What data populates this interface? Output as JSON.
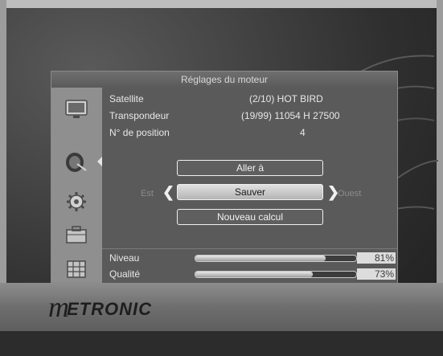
{
  "window": {
    "title": "Réglages du moteur"
  },
  "info": {
    "satellite_label": "Satellite",
    "satellite_value": "(2/10) HOT BIRD",
    "transponder_label": "Transpondeur",
    "transponder_value": "(19/99) 11054 H 27500",
    "position_label": "N° de position",
    "position_value": "4"
  },
  "actions": {
    "goto_label": "Aller à",
    "save_label": "Sauver",
    "recalc_label": "Nouveau calcul"
  },
  "direction": {
    "east": "Est",
    "west": "Ouest",
    "left_arrow": "❮",
    "right_arrow": "❯"
  },
  "signal": {
    "level_label": "Niveau",
    "level_value": "81%",
    "level_fraction": 0.81,
    "quality_label": "Qualité",
    "quality_value": "73%",
    "quality_fraction": 0.73
  },
  "sidebar": {
    "items": [
      "tv-icon",
      "satellite-dish-icon",
      "gear-icon",
      "toolbox-icon",
      "grid-box-icon"
    ],
    "selected_index": 1
  },
  "brand": {
    "logo_initial": "m",
    "logo_text": "ETRONIC"
  },
  "colors": {
    "panel": "#5a5a5a",
    "sidebar": "#8f8f8f",
    "footer": "#7a7a7a"
  }
}
